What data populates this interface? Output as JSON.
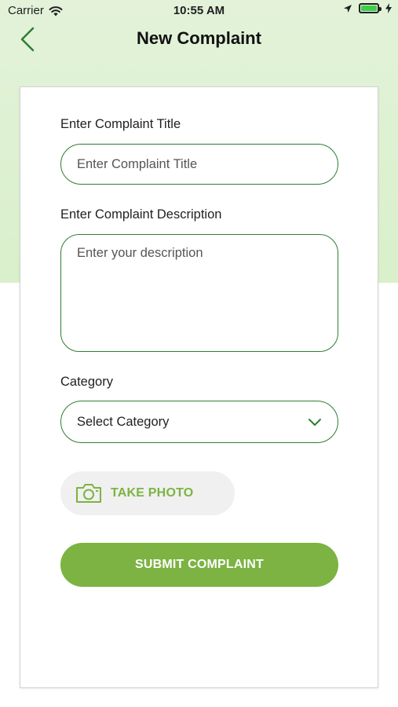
{
  "status_bar": {
    "carrier": "Carrier",
    "time": "10:55 AM",
    "battery_level": 1.0,
    "wifi_icon": "wifi-icon",
    "location_icon": "location-arrow-icon",
    "charging_icon": "charging-bolt-icon"
  },
  "nav": {
    "title": "New Complaint",
    "back_icon": "chevron-left-icon"
  },
  "form": {
    "title_label": "Enter Complaint Title",
    "title_placeholder": "Enter Complaint Title",
    "description_label": "Enter Complaint Description",
    "description_placeholder": "Enter your description",
    "category_label": "Category",
    "category_value": "Select Category",
    "category_icon": "chevron-down-icon",
    "photo_label": "TAKE PHOTO",
    "photo_icon": "camera-icon",
    "submit_label": "SUBMIT COMPLAINT"
  },
  "colors": {
    "accent": "#7cb342",
    "field_border": "#2e7d32",
    "header_bg": "#dff1d4"
  }
}
